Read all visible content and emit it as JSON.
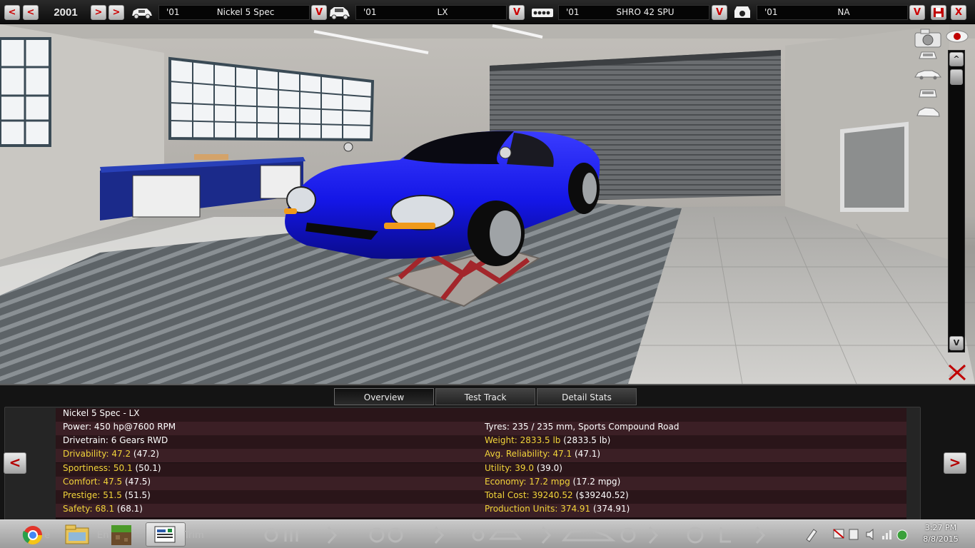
{
  "topbar": {
    "prev_label": "<",
    "next_label": ">",
    "year": "2001",
    "model": {
      "year": "'01",
      "name": "Nickel 5 Spec"
    },
    "trim": {
      "year": "'01",
      "name": "LX"
    },
    "engine": {
      "year": "'01",
      "name": "SHRO 42 SPU"
    },
    "aspiration": {
      "year": "'01",
      "name": "NA"
    },
    "dropdown_label": "V",
    "save_icon": "floppy-disk-icon",
    "close_label": "X"
  },
  "viewport": {
    "car_color": "#1416e6",
    "scroll_up_label": "^",
    "scroll_down_label": "V"
  },
  "tabs": [
    {
      "label": "Overview",
      "active": true
    },
    {
      "label": "Test Track",
      "active": false
    },
    {
      "label": "Detail Stats",
      "active": false
    }
  ],
  "stats": {
    "title": "Nickel 5 Spec - LX",
    "power": "Power: 450 hp@7600 RPM",
    "drivetrain": "Drivetrain: 6 Gears RWD",
    "tyres": "Tyres: 235 / 235 mm, Sports Compound Road",
    "drivability": {
      "label": "Drivability: 47.2",
      "extra": " (47.2)"
    },
    "sportiness": {
      "label": "Sportiness: 50.1",
      "extra": " (50.1)"
    },
    "comfort": {
      "label": "Comfort: 47.5",
      "extra": " (47.5)"
    },
    "prestige": {
      "label": "Prestige: 51.5",
      "extra": " (51.5)"
    },
    "safety": {
      "label": "Safety: 68.1",
      "extra": " (68.1)"
    },
    "weight": {
      "label": "Weight: 2833.5 lb",
      "extra": " (2833.5 lb)"
    },
    "reliability": {
      "label": "Avg. Reliability: 47.1",
      "extra": " (47.1)"
    },
    "utility": {
      "label": "Utility: 39.0",
      "extra": " (39.0)"
    },
    "economy": {
      "label": "Economy: 17.2 mpg",
      "extra": " (17.2 mpg)"
    },
    "total_cost": {
      "label": "Total Cost: 39240.52",
      "extra": " ($39240.52)"
    },
    "production": {
      "label": "Production Units: 374.91",
      "extra": " (374.91)"
    }
  },
  "nav": {
    "prev_label": "<",
    "next_label": ">"
  },
  "taskbar": {
    "ghost_left": "e",
    "ghost_en": "En",
    "ghost_trim": "Trim",
    "time": "3:27 PM",
    "date": "8/8/2015"
  },
  "colors": {
    "highlight": "#f2d43a",
    "accent_red": "#c00000"
  }
}
